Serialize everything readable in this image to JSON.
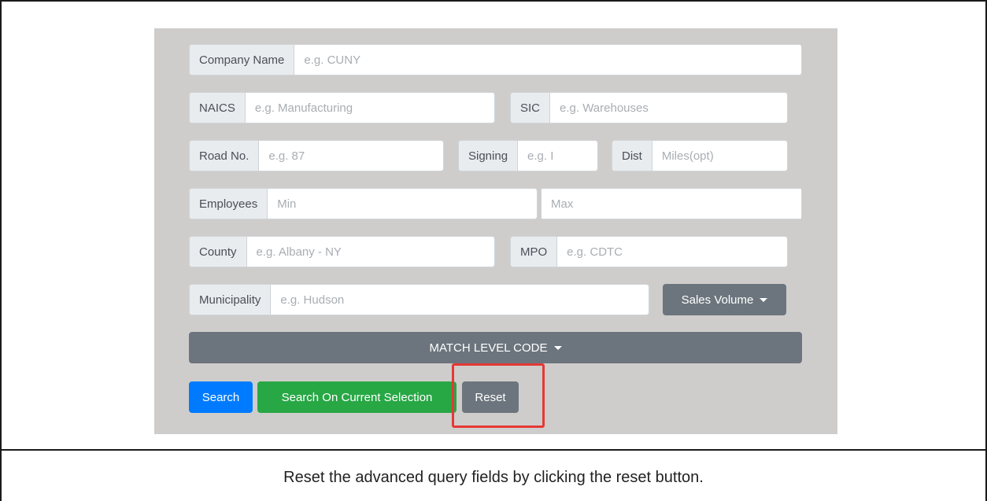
{
  "form": {
    "company": {
      "label": "Company Name",
      "placeholder": "e.g. CUNY"
    },
    "naics": {
      "label": "NAICS",
      "placeholder": "e.g. Manufacturing"
    },
    "sic": {
      "label": "SIC",
      "placeholder": "e.g. Warehouses"
    },
    "road": {
      "label": "Road No.",
      "placeholder": "e.g. 87"
    },
    "signing": {
      "label": "Signing",
      "placeholder": "e.g. I"
    },
    "dist": {
      "label": "Dist",
      "placeholder": "Miles(opt)"
    },
    "employees": {
      "label": "Employees",
      "min_placeholder": "Min",
      "max_placeholder": "Max"
    },
    "county": {
      "label": "County",
      "placeholder": "e.g. Albany - NY"
    },
    "mpo": {
      "label": "MPO",
      "placeholder": "e.g. CDTC"
    },
    "municipality": {
      "label": "Municipality",
      "placeholder": "e.g. Hudson"
    },
    "sales_volume_label": "Sales Volume",
    "match_level_label": "MATCH LEVEL CODE"
  },
  "actions": {
    "search_label": "Search",
    "search_current_label": "Search On Current Selection",
    "reset_label": "Reset"
  },
  "annotation": {
    "highlight_color": "#e53935"
  },
  "caption": "Reset the advanced query fields by clicking the reset button."
}
